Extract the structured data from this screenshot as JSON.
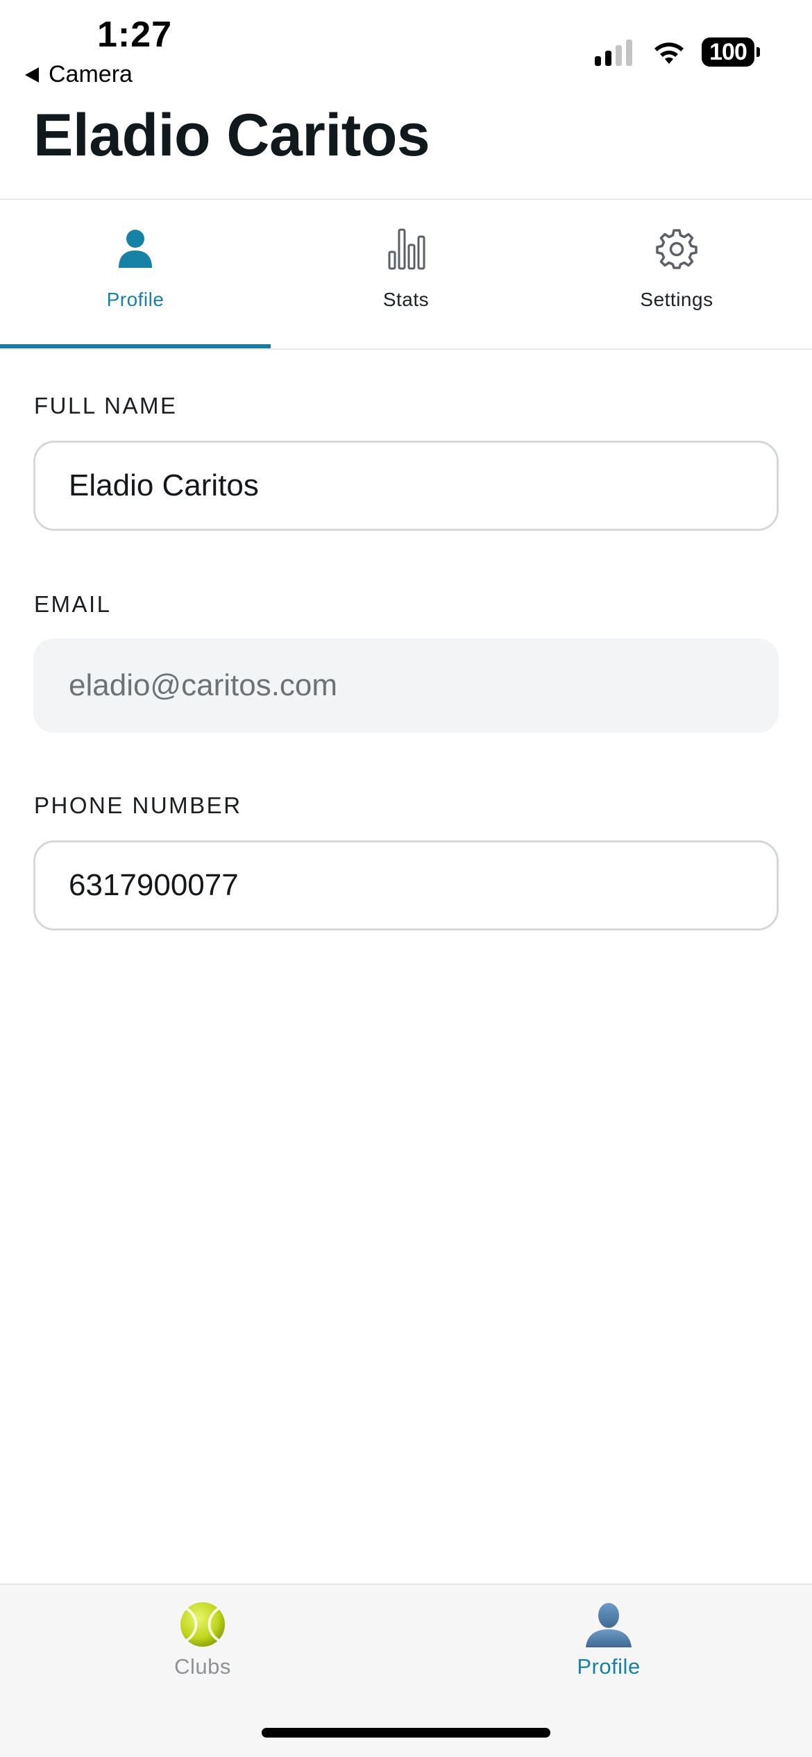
{
  "status_bar": {
    "time": "1:27",
    "back_label": "Camera",
    "battery_level": "100"
  },
  "header": {
    "title": "Eladio Caritos"
  },
  "tabs": [
    {
      "label": "Profile",
      "icon": "person-icon",
      "active": true
    },
    {
      "label": "Stats",
      "icon": "bar-chart-icon",
      "active": false
    },
    {
      "label": "Settings",
      "icon": "gear-icon",
      "active": false
    }
  ],
  "form": {
    "full_name": {
      "label": "FULL NAME",
      "value": "Eladio Caritos"
    },
    "email": {
      "label": "EMAIL",
      "value": "eladio@caritos.com",
      "editable": false
    },
    "phone": {
      "label": "PHONE NUMBER",
      "value": "6317900077"
    }
  },
  "bottom_tabs": [
    {
      "label": "Clubs",
      "icon": "tennis-ball-icon",
      "active": false
    },
    {
      "label": "Profile",
      "icon": "person-silhouette-icon",
      "active": true
    }
  ],
  "colors": {
    "accent": "#1781a6",
    "tab_underline": "#1a7aa0",
    "text_dark": "#12191d",
    "inactive_tab_text": "#8e9296",
    "field_border": "#d5d8da",
    "readonly_bg": "#f3f4f5"
  }
}
